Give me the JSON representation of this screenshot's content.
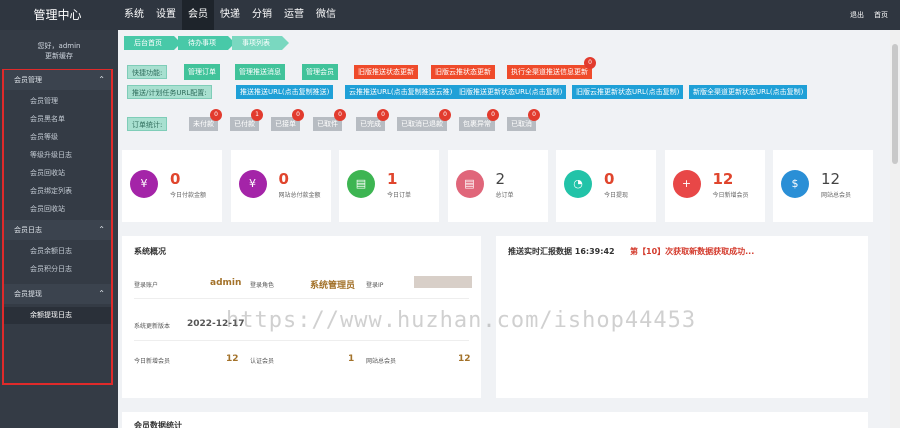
{
  "brand": "管理中心",
  "topnav": [
    "系统",
    "设置",
    "会员",
    "快递",
    "分销",
    "运营",
    "微信"
  ],
  "topnav_active": 2,
  "top_right": {
    "logout": "退出",
    "home": "首页"
  },
  "user": {
    "greeting": "您好，admin",
    "clear_cache": "更新缓存"
  },
  "sidebar": {
    "groups": [
      {
        "title": "会员管理",
        "items": [
          "会员管理",
          "会员黑名单",
          "会员等级",
          "等级升级日志",
          "会员回收站",
          "会员绑定列表",
          "会员回收站"
        ]
      },
      {
        "title": "会员日志",
        "items": [
          "会员余额日志",
          "会员积分日志"
        ]
      },
      {
        "title": "会员提现",
        "items": [
          "余额提现日志"
        ]
      }
    ],
    "active_item": "余额提现日志"
  },
  "breadcrumb": [
    "后台首页",
    "待办事项",
    "事项列表"
  ],
  "quick": {
    "label": "快捷功能:",
    "buttons": [
      "管理订单",
      "管理推送消息",
      "管理会员"
    ],
    "red_buttons": [
      "旧版推送状态更新",
      "旧版云推状态更新",
      "执行全渠道推送信息更新"
    ],
    "red_badge": "0"
  },
  "task_urls": {
    "label": "推送/计划任务URL配置:",
    "buttons": [
      "推送推送URL(点击复制推送)",
      "云推推送URL(点击复制推送云推)",
      "旧版推送更新状态URL(点击复制)",
      "旧版云推更新状态URL(点击复制)",
      "新版全渠道更新状态URL(点击复制)"
    ]
  },
  "orders": {
    "label": "订单统计:",
    "items": [
      {
        "label": "未付款",
        "count": "0"
      },
      {
        "label": "已付款",
        "count": "1"
      },
      {
        "label": "已接单",
        "count": "0"
      },
      {
        "label": "已取件",
        "count": "0"
      },
      {
        "label": "已完成",
        "count": "0"
      },
      {
        "label": "已取消已退款",
        "count": "0"
      },
      {
        "label": "包裹异常",
        "count": "0"
      },
      {
        "label": "已取消",
        "count": "0"
      }
    ]
  },
  "stats": [
    {
      "value": "0",
      "label": "今日付款金额",
      "icon": "yuan-icon",
      "glyph": "¥",
      "color": "#a424a8"
    },
    {
      "value": "0",
      "label": "网站总付款金额",
      "icon": "yuan-icon",
      "glyph": "¥",
      "color": "#a424a8"
    },
    {
      "value": "1",
      "label": "今日订单",
      "icon": "document-icon",
      "glyph": "▤",
      "color": "#3db552"
    },
    {
      "value": "2",
      "label": "总订单",
      "icon": "list-icon",
      "glyph": "▤",
      "color": "#e0667a"
    },
    {
      "value": "0",
      "label": "今日提现",
      "icon": "pie-icon",
      "glyph": "◔",
      "color": "#22c3a8"
    },
    {
      "value": "12",
      "label": "今日新增会员",
      "icon": "add-user-icon",
      "glyph": "+",
      "color": "#e84747"
    },
    {
      "value": "12",
      "label": "网站总会员",
      "icon": "money-bag-icon",
      "glyph": "$",
      "color": "#2a8fd6"
    }
  ],
  "system": {
    "title": "系统概况",
    "login_account_label": "登录账户",
    "login_account": "admin",
    "login_role_label": "登录角色",
    "login_role": "系统管理员",
    "login_ip_label": "登录IP",
    "version_label": "系统更新版本",
    "version": "2022-12-17",
    "new_members_label": "今日新增会员",
    "new_members": "12",
    "verified_label": "认证会员",
    "verified": "1",
    "total_members_label": "网站总会员",
    "total_members": "12"
  },
  "push": {
    "title": "推送实时汇报数据 16:39:42",
    "message": "第【10】次获取新数据获取成功..."
  },
  "bottom_title": "会员数据统计",
  "watermark": "https://www.huzhan.com/ishop44453"
}
